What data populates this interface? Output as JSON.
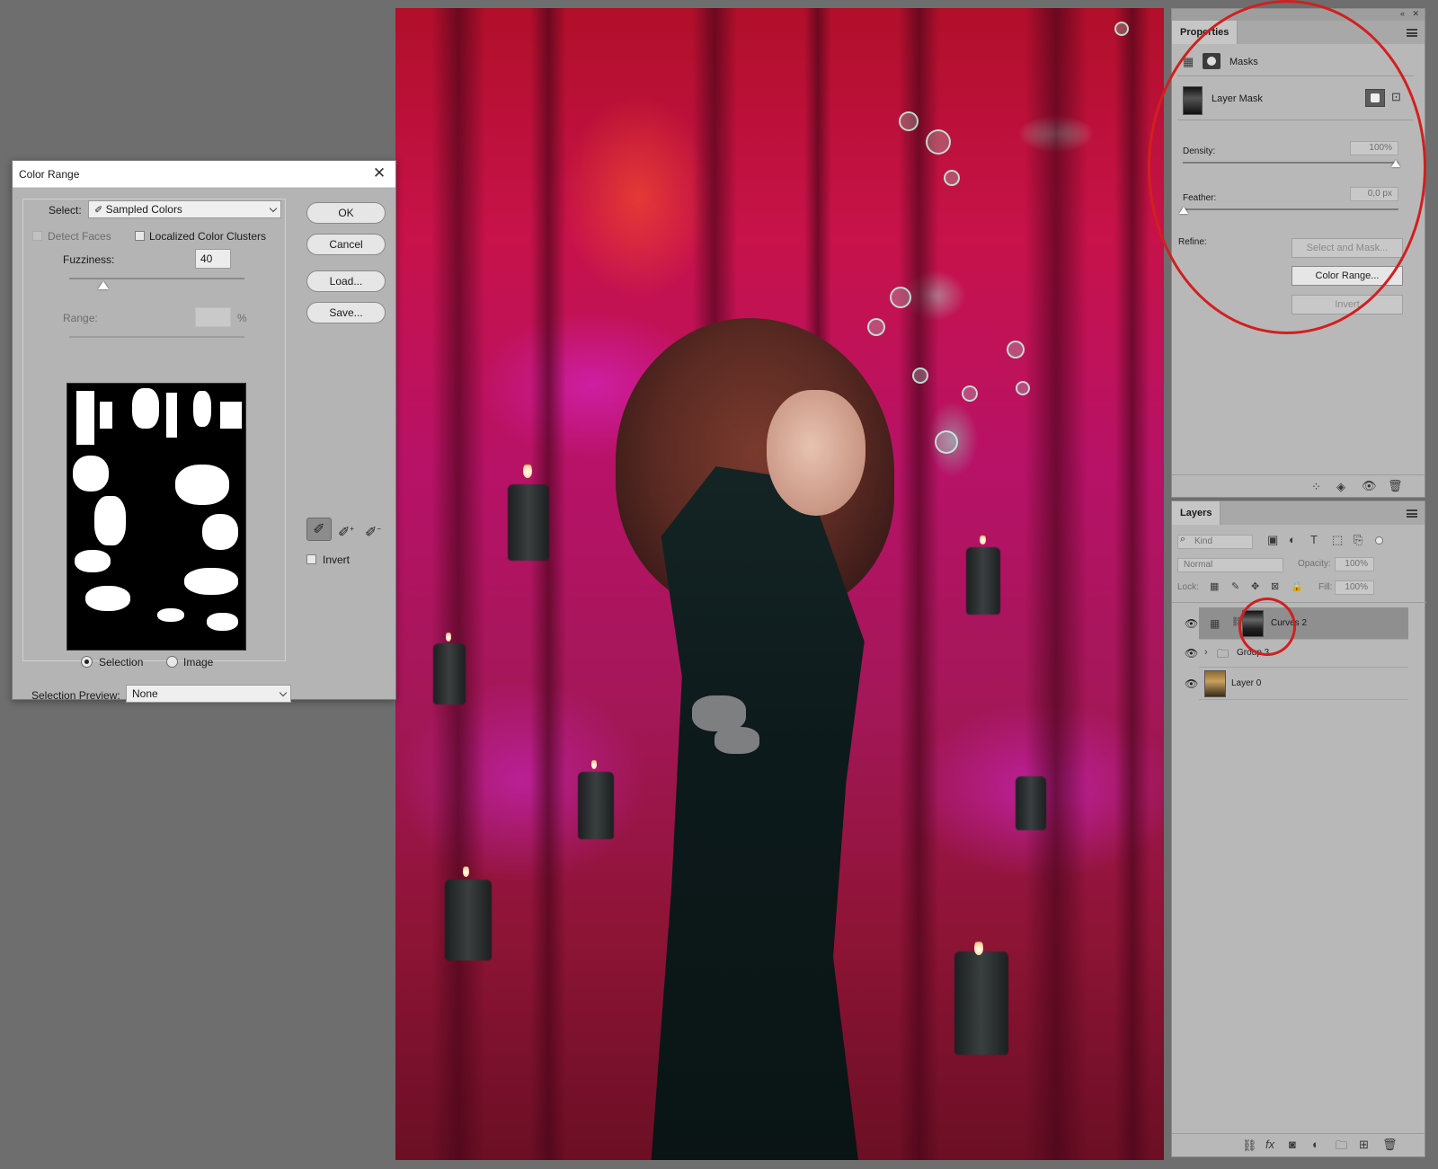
{
  "color_range": {
    "title": "Color Range",
    "select_label": "Select:",
    "select_value": "Sampled Colors",
    "detect_faces": "Detect Faces",
    "localized": "Localized Color Clusters",
    "fuzziness_label": "Fuzziness:",
    "fuzziness_value": "40",
    "range_label": "Range:",
    "range_unit": "%",
    "radio_selection": "Selection",
    "radio_image": "Image",
    "preview_label": "Selection Preview:",
    "preview_value": "None",
    "ok": "OK",
    "cancel": "Cancel",
    "load": "Load...",
    "save": "Save...",
    "invert": "Invert"
  },
  "properties": {
    "tab": "Properties",
    "masks_label": "Masks",
    "layer_mask": "Layer Mask",
    "density_label": "Density:",
    "density_value": "100%",
    "feather_label": "Feather:",
    "feather_value": "0,0 px",
    "refine_label": "Refine:",
    "select_mask": "Select and Mask...",
    "color_range": "Color Range...",
    "invert": "Invert"
  },
  "layers": {
    "tab": "Layers",
    "kind": "Kind",
    "blend": "Normal",
    "opacity_label": "Opacity:",
    "opacity_value": "100%",
    "lock_label": "Lock:",
    "fill_label": "Fill:",
    "fill_value": "100%",
    "items": [
      {
        "name": "Curves 2"
      },
      {
        "name": "Group 3"
      },
      {
        "name": "Layer 0"
      }
    ]
  },
  "icons": {
    "eyedropper": "eyedropper-icon",
    "eye": "eye-icon",
    "trash": "trash-icon",
    "menu": "panel-menu-icon"
  },
  "colors": {
    "annotation": "#d21f1f"
  }
}
